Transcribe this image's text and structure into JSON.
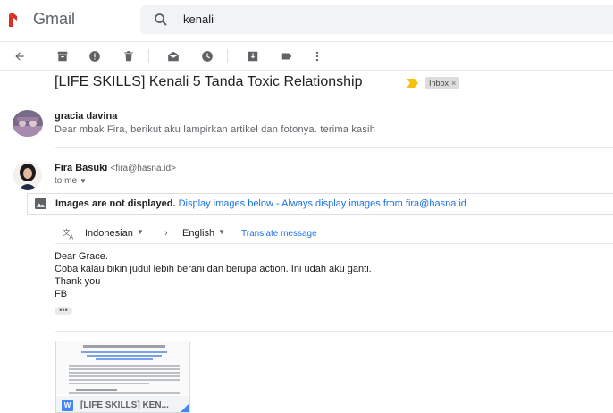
{
  "app": {
    "name": "Gmail"
  },
  "search": {
    "value": "kenali"
  },
  "email": {
    "subject": "[LIFE SKILLS] Kenali 5 Tanda Toxic Relationship",
    "label_chip": "Inbox",
    "label_chip_close": "×"
  },
  "messages": [
    {
      "sender": "gracia davina",
      "snippet": "Dear mbak Fira, berikut aku lampirkan artikel dan fotonya. terima kasih"
    },
    {
      "sender": "Fira Basuki",
      "email": "<fira@hasna.id>",
      "recipient": "to me",
      "images_notice": {
        "bold": "Images are not displayed.",
        "link1": "Display images below",
        "sep": " - ",
        "link2": "Always display images from fira@hasna.id"
      },
      "translate": {
        "from": "Indonesian",
        "arrow": "›",
        "to": "English",
        "action": "Translate message"
      },
      "body_lines": [
        "Dear Grace.",
        "Coba kalau bikin judul lebih berani dan berupa action. Ini udah aku ganti.",
        "Thank you",
        "FB"
      ],
      "show_trimmed": "•••",
      "attachment": {
        "type_badge": "W",
        "name": "[LIFE SKILLS] KEN..."
      }
    }
  ],
  "icons": {
    "back": "arrow-left-icon",
    "archive": "archive-icon",
    "spam": "report-spam-icon",
    "delete": "trash-icon",
    "unread": "mark-unread-icon",
    "snooze": "clock-icon",
    "move": "move-to-icon",
    "label": "label-icon",
    "more": "more-vert-icon"
  },
  "colors": {
    "gmail_red": "#d93025",
    "link_blue": "#1a73e8",
    "important_yellow": "#f4c20d",
    "word_blue": "#4285f4"
  }
}
